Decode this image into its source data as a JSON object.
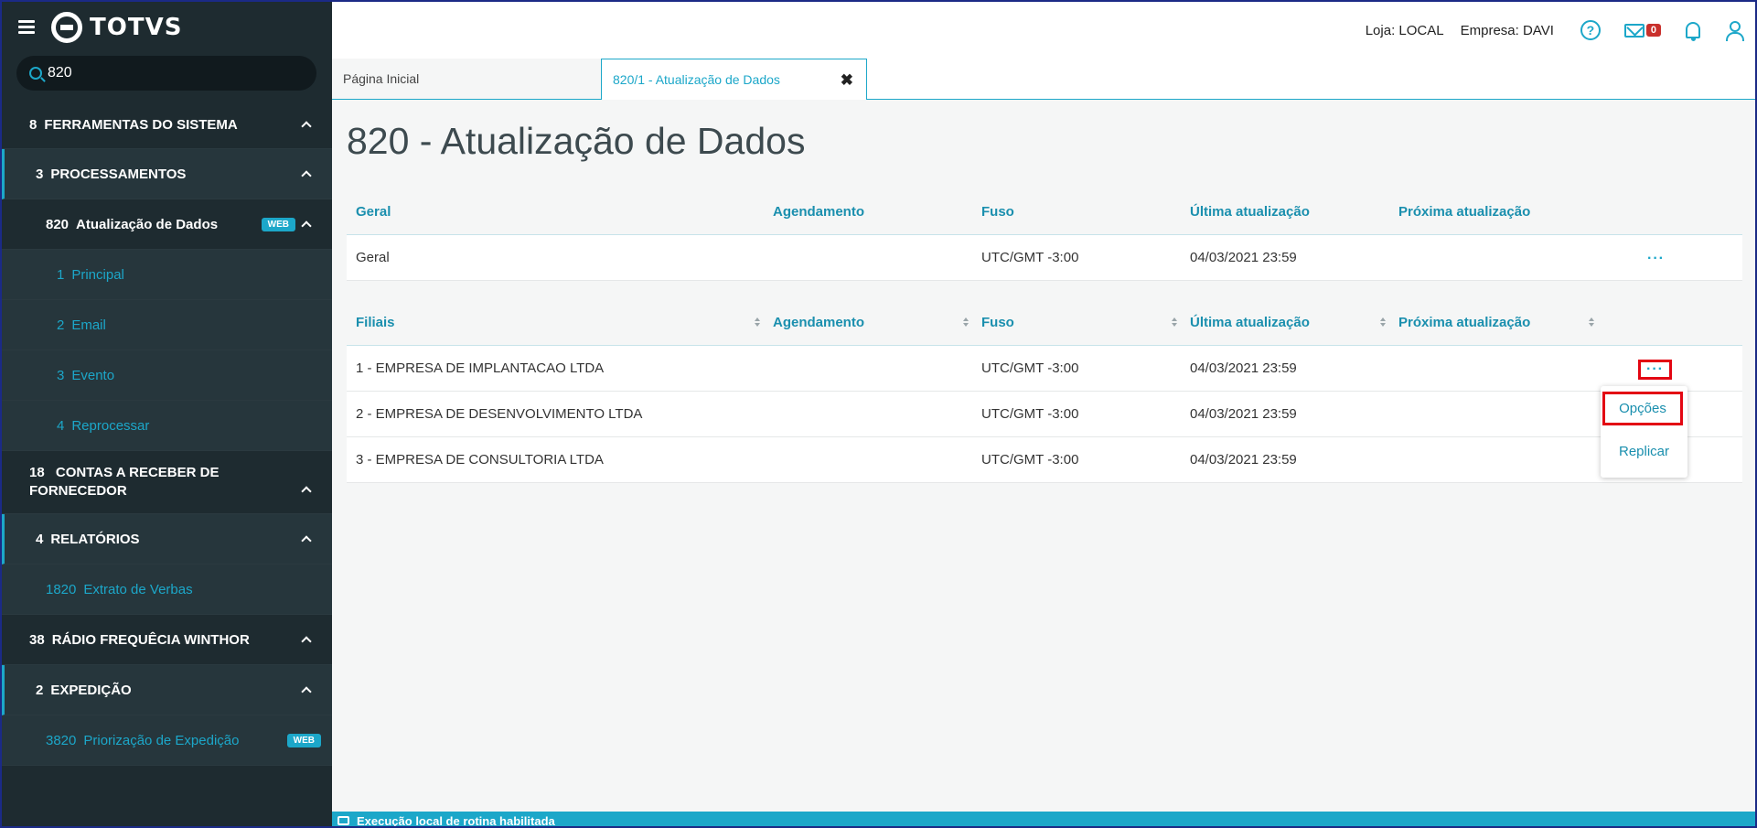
{
  "app": {
    "logo_text": "TOTVS"
  },
  "search": {
    "value": "820"
  },
  "sidebar": {
    "items": [
      {
        "code": "8",
        "label": "FERRAMENTAS DO SISTEMA"
      },
      {
        "code": "3",
        "label": "PROCESSAMENTOS"
      },
      {
        "code": "820",
        "label": "Atualização de Dados",
        "badge": "WEB"
      },
      {
        "code": "1",
        "label": "Principal"
      },
      {
        "code": "2",
        "label": "Email"
      },
      {
        "code": "3",
        "label": "Evento"
      },
      {
        "code": "4",
        "label": "Reprocessar"
      },
      {
        "code": "18",
        "label": "CONTAS A RECEBER DE FORNECEDOR"
      },
      {
        "code": "4",
        "label": "RELATÓRIOS"
      },
      {
        "code": "1820",
        "label": "Extrato de Verbas"
      },
      {
        "code": "38",
        "label": "RÁDIO FREQUÊCIA WINTHOR"
      },
      {
        "code": "2",
        "label": "EXPEDIÇÃO"
      },
      {
        "code": "3820",
        "label": "Priorização de Expedição",
        "badge": "WEB"
      }
    ]
  },
  "header": {
    "loja": "Loja: LOCAL",
    "empresa": "Empresa: DAVI",
    "help_icon": "?",
    "mail_badge": "0"
  },
  "tabs": [
    {
      "label": "Página Inicial"
    },
    {
      "label": "820/1 - Atualização de Dados",
      "close": "✖"
    }
  ],
  "page": {
    "title": "820 - Atualização de Dados"
  },
  "geral_table": {
    "headers": [
      "Geral",
      "Agendamento",
      "Fuso",
      "Última atualização",
      "Próxima atualização"
    ],
    "rows": [
      {
        "nome": "Geral",
        "agendamento": "",
        "fuso": "UTC/GMT -3:00",
        "ultima": "04/03/2021 23:59",
        "proxima": "",
        "actions": "···"
      }
    ]
  },
  "filiais_table": {
    "headers": [
      "Filiais",
      "Agendamento",
      "Fuso",
      "Última atualização",
      "Próxima atualização"
    ],
    "rows": [
      {
        "nome": "1 - EMPRESA DE IMPLANTACAO LTDA",
        "agendamento": "",
        "fuso": "UTC/GMT -3:00",
        "ultima": "04/03/2021 23:59",
        "proxima": "",
        "actions": "···"
      },
      {
        "nome": "2 - EMPRESA DE DESENVOLVIMENTO LTDA",
        "agendamento": "",
        "fuso": "UTC/GMT -3:00",
        "ultima": "04/03/2021 23:59",
        "proxima": ""
      },
      {
        "nome": "3 - EMPRESA DE CONSULTORIA LTDA",
        "agendamento": "",
        "fuso": "UTC/GMT -3:00",
        "ultima": "04/03/2021 23:59",
        "proxima": ""
      }
    ]
  },
  "row_menu": {
    "items": [
      "Opções",
      "Replicar"
    ]
  },
  "status_bar": {
    "text": "Execução local de rotina habilitada"
  },
  "colors": {
    "accent": "#1ca7c9",
    "sidebar_bg": "#1e2b30",
    "highlight": "#e30613"
  }
}
